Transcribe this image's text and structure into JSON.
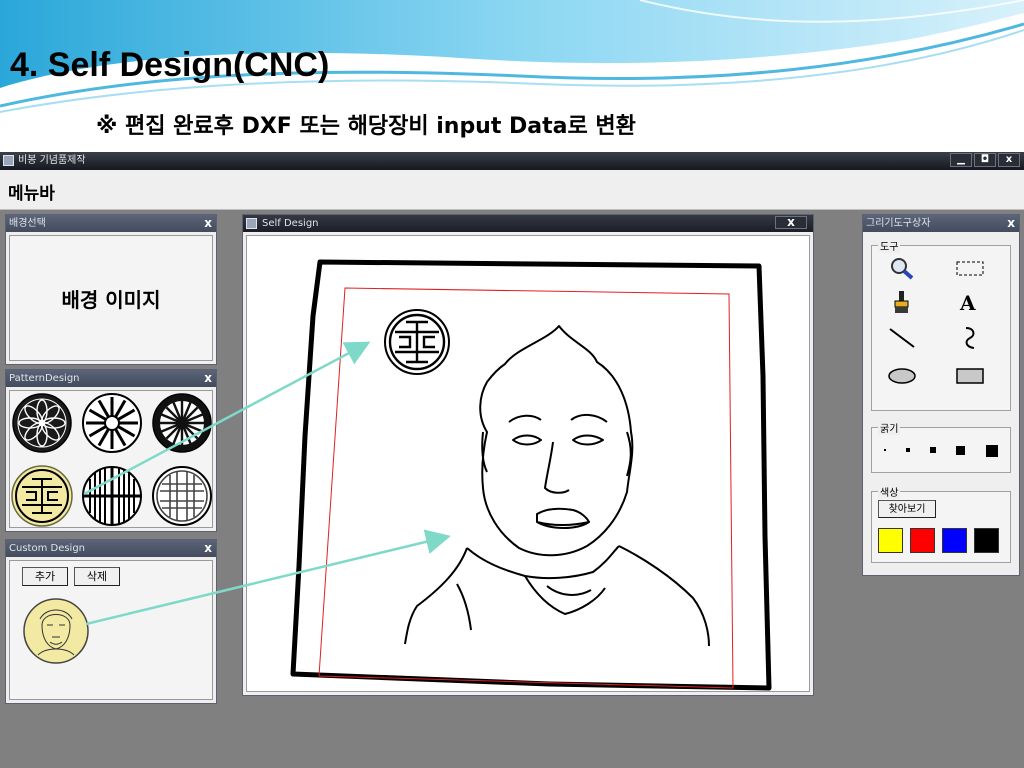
{
  "slide": {
    "title": "4. Self Design(CNC)",
    "subtitle": "※ 편집 완료후 DXF 또는 해당장비 input Data로 변환"
  },
  "app": {
    "title": "비봉 기념품제작",
    "window_buttons": {
      "minimize": "▁",
      "restore": "◘",
      "close": "x"
    },
    "menubar_label": "메뉴바"
  },
  "background_panel": {
    "title": "배경선택",
    "close": "x",
    "content_label": "배경 이미지"
  },
  "pattern_panel": {
    "title": "PatternDesign",
    "close": "x",
    "patterns": [
      "flower-pattern",
      "daisy-pattern",
      "wheel-pattern",
      "longevity-symbol-pattern",
      "vertical-lines-pattern",
      "maze-pattern"
    ],
    "selected_pattern": "longevity-symbol-pattern"
  },
  "custom_panel": {
    "title": "Custom Design",
    "close": "x",
    "add_button": "추가",
    "delete_button": "삭제"
  },
  "design_window": {
    "title": "Self Design",
    "close": "x"
  },
  "tool_panel": {
    "title": "그리기도구상자",
    "close": "x",
    "tools_label": "도구",
    "thickness_label": "굵기",
    "color_label": "색상",
    "browse_button": "찾아보기",
    "thickness_levels": [
      1,
      2,
      3,
      4,
      5
    ],
    "colors": [
      "#ffff00",
      "#ff0000",
      "#0000ff",
      "#000000"
    ]
  },
  "annotation_color": "#7fd9c9"
}
